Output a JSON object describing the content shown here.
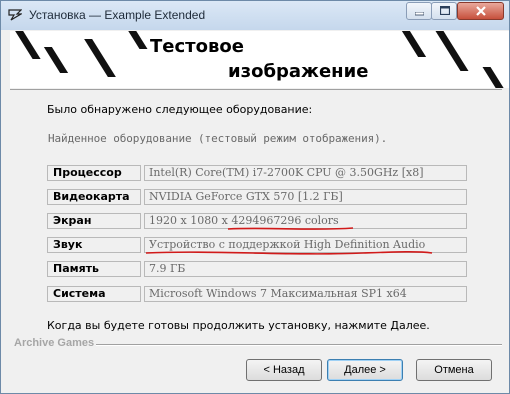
{
  "window": {
    "title": "Установка — Example Extended",
    "controls": {
      "minimize": "minimize",
      "maximize": "maximize",
      "close": "close"
    }
  },
  "banner": {
    "title_line1": "Тестовое",
    "title_line2": "изображение"
  },
  "main": {
    "intro": "Было обнаружено следующее оборудование:",
    "subheading": "Найденное оборудование (тестовый режим отображения).",
    "hardware": [
      {
        "label": "Процессор",
        "value": "Intel(R) Core(TM) i7-2700K CPU @ 3.50GHz [x8]"
      },
      {
        "label": "Видеокарта",
        "value": "NVIDIA GeForce GTX 570 [1.2 ГБ]"
      },
      {
        "label": "Экран",
        "value": "1920 x 1080 x 4294967296 colors"
      },
      {
        "label": "Звук",
        "value": "Устройство с поддержкой High Definition Audio"
      },
      {
        "label": "Память",
        "value": "7.9 ГБ"
      },
      {
        "label": "Система",
        "value": "Microsoft Windows 7 Максимальная SP1 x64"
      }
    ],
    "footer_note": "Когда вы будете готовы продолжить установку, нажмите Далее."
  },
  "footer": {
    "brand": "Archive Games",
    "back_label": "< Назад",
    "next_label": "Далее >",
    "cancel_label": "Отмена"
  },
  "colors": {
    "annotation": "#d11a1a",
    "titlebar": "#c5d7ec"
  }
}
